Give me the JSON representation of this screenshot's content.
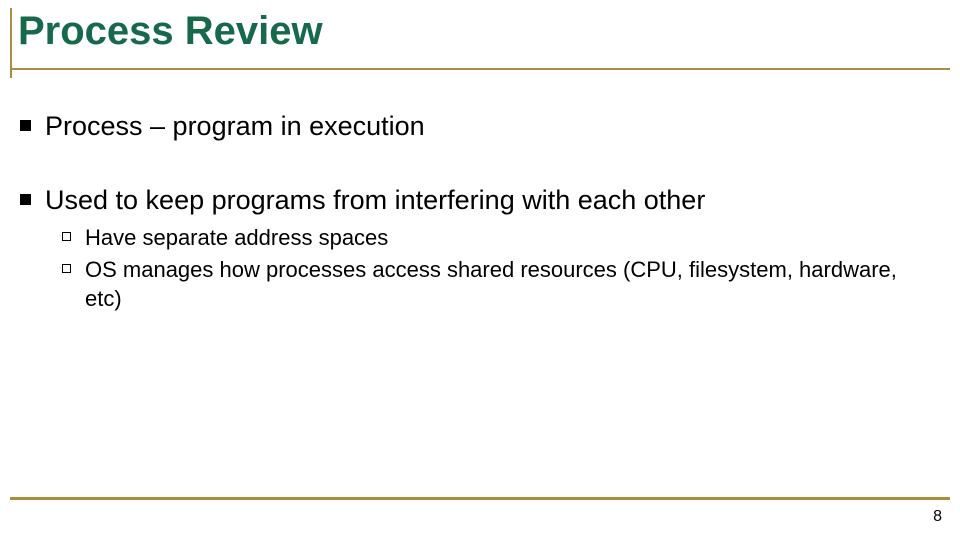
{
  "title": "Process Review",
  "bullets": [
    {
      "text": "Process – program in execution",
      "children": []
    },
    {
      "text": "Used to keep programs from interfering with each other",
      "children": [
        {
          "text": "Have separate address spaces"
        },
        {
          "text": "OS manages how processes access shared resources (CPU, filesystem, hardware, etc)"
        }
      ]
    }
  ],
  "page_number": "8"
}
